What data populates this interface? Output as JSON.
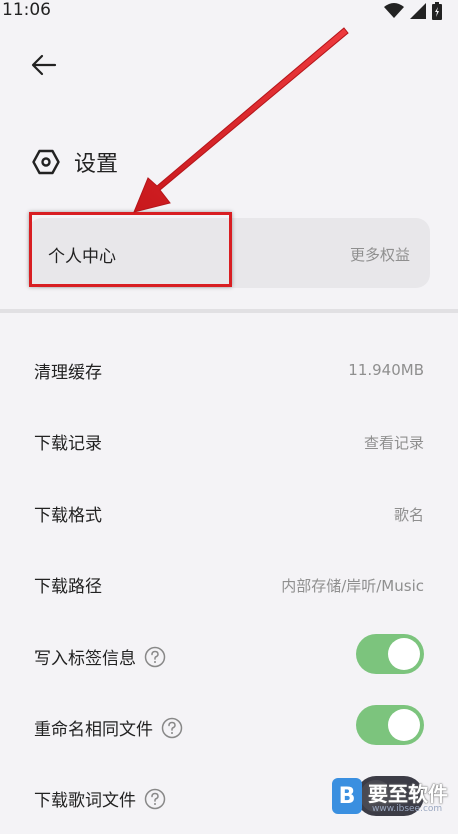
{
  "status_bar": {
    "time": "11:06"
  },
  "header": {
    "title": "设置"
  },
  "profile_card": {
    "label": "个人中心",
    "more_label": "更多权益"
  },
  "settings": [
    {
      "label": "清理缓存",
      "value": "11.940MB"
    },
    {
      "label": "下载记录",
      "value": "查看记录"
    },
    {
      "label": "下载格式",
      "value": "歌名"
    },
    {
      "label": "下载路径",
      "value": "内部存储/岸听/Music"
    },
    {
      "label": "写入标签信息",
      "toggle": true
    },
    {
      "label": "重命名相同文件",
      "toggle": true
    },
    {
      "label": "下载歌词文件",
      "toggle": false
    }
  ],
  "watermark": {
    "text": "要至软件",
    "url": "www.ibsee.com"
  },
  "colors": {
    "accent_green": "#7cc47d",
    "annotation_red": "#d81e22",
    "background": "#f4f3f6"
  },
  "icons": [
    "back-arrow-icon",
    "settings-hexagon-icon",
    "help-icon",
    "wifi-icon",
    "signal-icon",
    "battery-icon"
  ]
}
